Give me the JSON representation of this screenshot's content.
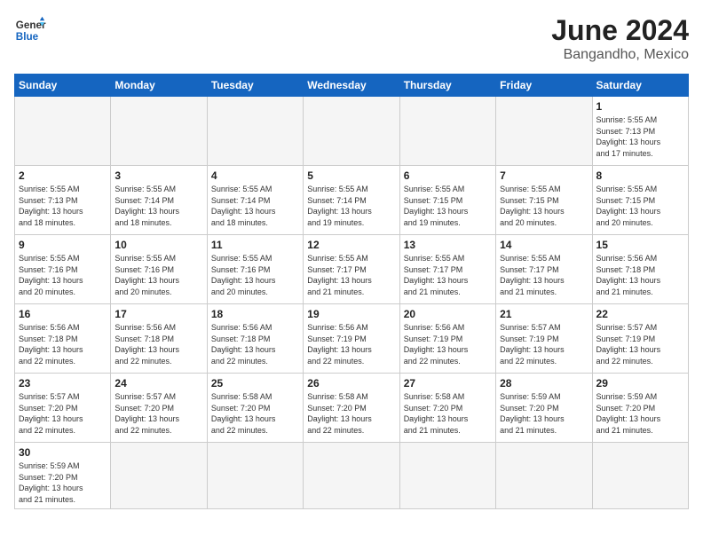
{
  "header": {
    "logo_general": "General",
    "logo_blue": "Blue",
    "title": "June 2024",
    "subtitle": "Bangandho, Mexico"
  },
  "days_of_week": [
    "Sunday",
    "Monday",
    "Tuesday",
    "Wednesday",
    "Thursday",
    "Friday",
    "Saturday"
  ],
  "weeks": [
    [
      {
        "day": "",
        "info": ""
      },
      {
        "day": "",
        "info": ""
      },
      {
        "day": "",
        "info": ""
      },
      {
        "day": "",
        "info": ""
      },
      {
        "day": "",
        "info": ""
      },
      {
        "day": "",
        "info": ""
      },
      {
        "day": "1",
        "info": "Sunrise: 5:55 AM\nSunset: 7:13 PM\nDaylight: 13 hours\nand 17 minutes."
      }
    ],
    [
      {
        "day": "2",
        "info": "Sunrise: 5:55 AM\nSunset: 7:13 PM\nDaylight: 13 hours\nand 18 minutes."
      },
      {
        "day": "3",
        "info": "Sunrise: 5:55 AM\nSunset: 7:14 PM\nDaylight: 13 hours\nand 18 minutes."
      },
      {
        "day": "4",
        "info": "Sunrise: 5:55 AM\nSunset: 7:14 PM\nDaylight: 13 hours\nand 18 minutes."
      },
      {
        "day": "5",
        "info": "Sunrise: 5:55 AM\nSunset: 7:14 PM\nDaylight: 13 hours\nand 19 minutes."
      },
      {
        "day": "6",
        "info": "Sunrise: 5:55 AM\nSunset: 7:15 PM\nDaylight: 13 hours\nand 19 minutes."
      },
      {
        "day": "7",
        "info": "Sunrise: 5:55 AM\nSunset: 7:15 PM\nDaylight: 13 hours\nand 20 minutes."
      },
      {
        "day": "8",
        "info": "Sunrise: 5:55 AM\nSunset: 7:15 PM\nDaylight: 13 hours\nand 20 minutes."
      }
    ],
    [
      {
        "day": "9",
        "info": "Sunrise: 5:55 AM\nSunset: 7:16 PM\nDaylight: 13 hours\nand 20 minutes."
      },
      {
        "day": "10",
        "info": "Sunrise: 5:55 AM\nSunset: 7:16 PM\nDaylight: 13 hours\nand 20 minutes."
      },
      {
        "day": "11",
        "info": "Sunrise: 5:55 AM\nSunset: 7:16 PM\nDaylight: 13 hours\nand 20 minutes."
      },
      {
        "day": "12",
        "info": "Sunrise: 5:55 AM\nSunset: 7:17 PM\nDaylight: 13 hours\nand 21 minutes."
      },
      {
        "day": "13",
        "info": "Sunrise: 5:55 AM\nSunset: 7:17 PM\nDaylight: 13 hours\nand 21 minutes."
      },
      {
        "day": "14",
        "info": "Sunrise: 5:55 AM\nSunset: 7:17 PM\nDaylight: 13 hours\nand 21 minutes."
      },
      {
        "day": "15",
        "info": "Sunrise: 5:56 AM\nSunset: 7:18 PM\nDaylight: 13 hours\nand 21 minutes."
      }
    ],
    [
      {
        "day": "16",
        "info": "Sunrise: 5:56 AM\nSunset: 7:18 PM\nDaylight: 13 hours\nand 22 minutes."
      },
      {
        "day": "17",
        "info": "Sunrise: 5:56 AM\nSunset: 7:18 PM\nDaylight: 13 hours\nand 22 minutes."
      },
      {
        "day": "18",
        "info": "Sunrise: 5:56 AM\nSunset: 7:18 PM\nDaylight: 13 hours\nand 22 minutes."
      },
      {
        "day": "19",
        "info": "Sunrise: 5:56 AM\nSunset: 7:19 PM\nDaylight: 13 hours\nand 22 minutes."
      },
      {
        "day": "20",
        "info": "Sunrise: 5:56 AM\nSunset: 7:19 PM\nDaylight: 13 hours\nand 22 minutes."
      },
      {
        "day": "21",
        "info": "Sunrise: 5:57 AM\nSunset: 7:19 PM\nDaylight: 13 hours\nand 22 minutes."
      },
      {
        "day": "22",
        "info": "Sunrise: 5:57 AM\nSunset: 7:19 PM\nDaylight: 13 hours\nand 22 minutes."
      }
    ],
    [
      {
        "day": "23",
        "info": "Sunrise: 5:57 AM\nSunset: 7:20 PM\nDaylight: 13 hours\nand 22 minutes."
      },
      {
        "day": "24",
        "info": "Sunrise: 5:57 AM\nSunset: 7:20 PM\nDaylight: 13 hours\nand 22 minutes."
      },
      {
        "day": "25",
        "info": "Sunrise: 5:58 AM\nSunset: 7:20 PM\nDaylight: 13 hours\nand 22 minutes."
      },
      {
        "day": "26",
        "info": "Sunrise: 5:58 AM\nSunset: 7:20 PM\nDaylight: 13 hours\nand 22 minutes."
      },
      {
        "day": "27",
        "info": "Sunrise: 5:58 AM\nSunset: 7:20 PM\nDaylight: 13 hours\nand 21 minutes."
      },
      {
        "day": "28",
        "info": "Sunrise: 5:59 AM\nSunset: 7:20 PM\nDaylight: 13 hours\nand 21 minutes."
      },
      {
        "day": "29",
        "info": "Sunrise: 5:59 AM\nSunset: 7:20 PM\nDaylight: 13 hours\nand 21 minutes."
      }
    ],
    [
      {
        "day": "30",
        "info": "Sunrise: 5:59 AM\nSunset: 7:20 PM\nDaylight: 13 hours\nand 21 minutes."
      },
      {
        "day": "",
        "info": ""
      },
      {
        "day": "",
        "info": ""
      },
      {
        "day": "",
        "info": ""
      },
      {
        "day": "",
        "info": ""
      },
      {
        "day": "",
        "info": ""
      },
      {
        "day": "",
        "info": ""
      }
    ]
  ]
}
